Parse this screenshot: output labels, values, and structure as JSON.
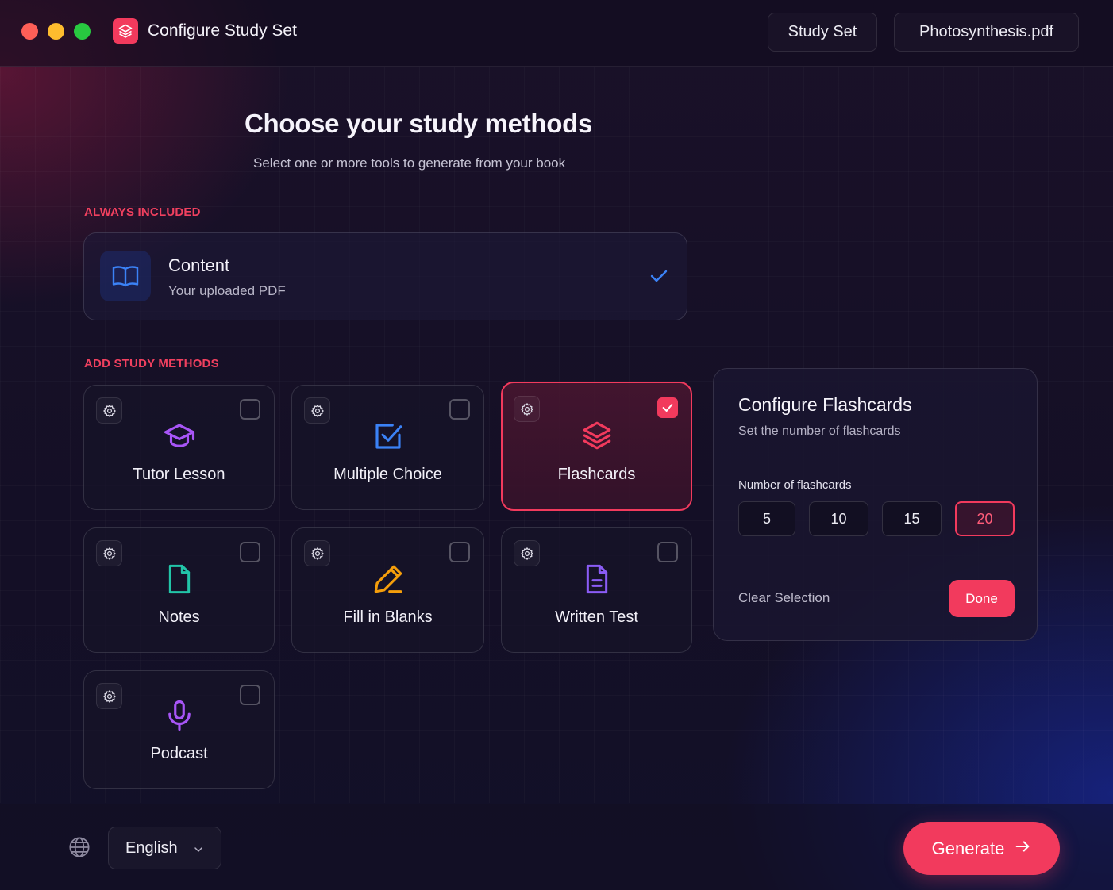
{
  "window": {
    "title": "Configure Study Set",
    "tabs": [
      {
        "label": "Study Set"
      },
      {
        "label": "Photosynthesis.pdf"
      }
    ]
  },
  "header": {
    "title": "Choose your study methods",
    "subtitle": "Select one or more tools to generate from your book"
  },
  "always_included": {
    "section_label": "ALWAYS INCLUDED",
    "card": {
      "title": "Content",
      "subtitle": "Your uploaded PDF",
      "icon": "book-open-icon",
      "checked": true
    }
  },
  "methods": {
    "section_label": "ADD STUDY METHODS",
    "items": [
      {
        "label": "Tutor Lesson",
        "icon": "graduation-cap-icon",
        "color": "#a855f7",
        "checked": false
      },
      {
        "label": "Multiple Choice",
        "icon": "checkbox-square-icon",
        "color": "#3b82f6",
        "checked": false
      },
      {
        "label": "Flashcards",
        "icon": "layers-icon",
        "color": "#f23a5d",
        "checked": true
      },
      {
        "label": "Notes",
        "icon": "document-icon",
        "color": "#22c5a8",
        "checked": false
      },
      {
        "label": "Fill in Blanks",
        "icon": "pencil-icon",
        "color": "#f59e0b",
        "checked": false
      },
      {
        "label": "Written Test",
        "icon": "document-lines-icon",
        "color": "#8b5cf6",
        "checked": false
      },
      {
        "label": "Podcast",
        "icon": "microphone-icon",
        "color": "#a855f7",
        "checked": false
      }
    ]
  },
  "config_panel": {
    "title": "Configure Flashcards",
    "subtitle": "Set the number of flashcards",
    "count_label": "Number of flashcards",
    "options": [
      "5",
      "10",
      "15",
      "20"
    ],
    "selected": "20",
    "clear_label": "Clear Selection",
    "done_label": "Done"
  },
  "footer": {
    "language": "English",
    "generate_label": "Generate"
  },
  "colors": {
    "accent": "#f23a5d",
    "background": "#130f24"
  }
}
